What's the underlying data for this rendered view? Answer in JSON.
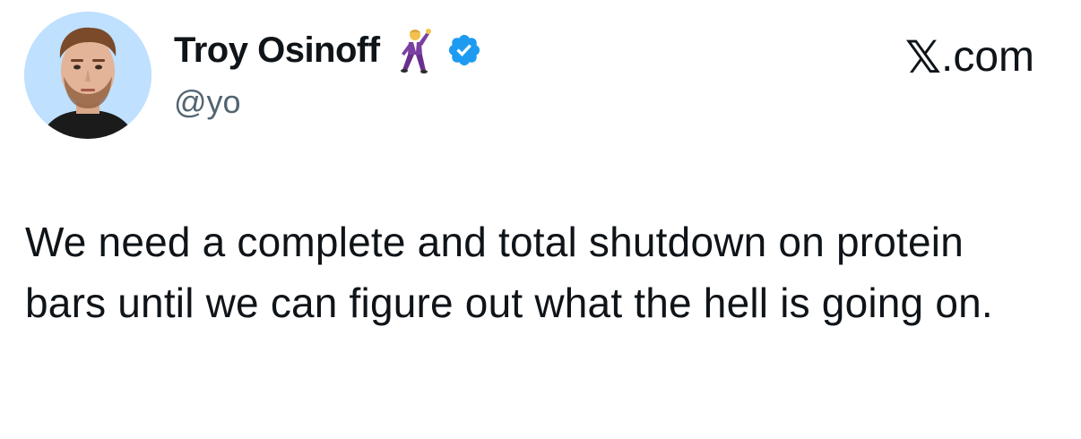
{
  "author": {
    "display_name": "Troy Osinoff",
    "handle": "@yo",
    "name_emoji": "dancing-man-emoji",
    "verified": true,
    "verified_color": "#1d9bf0",
    "avatar_bg": "#bfe0ff"
  },
  "site": {
    "label_x": "𝕏",
    "label_rest": ".com"
  },
  "tweet": {
    "text": "We need a complete and total shutdown on protein bars until we can figure out what the hell is going on."
  }
}
